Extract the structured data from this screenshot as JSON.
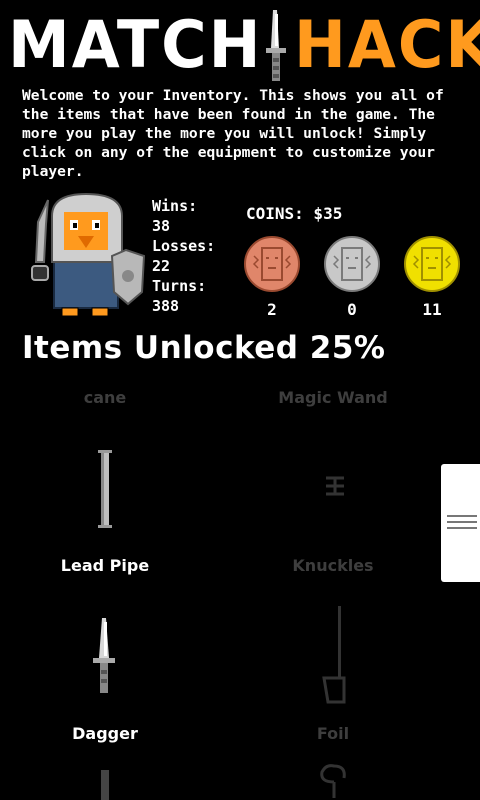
{
  "header": {
    "title_left": "MATCH",
    "title_right": "HACK"
  },
  "intro": "Welcome to your Inventory. This shows you all of the items that have been found in the game. The more you play the more you will unlock! Simply click on any of the equipment to customize your player.",
  "stats": {
    "wins_label": "Wins:",
    "wins": "38",
    "losses_label": "Losses:",
    "losses": "22",
    "turns_label": "Turns:",
    "turns": "388"
  },
  "coins": {
    "title": "COINS: $35",
    "bronze": "2",
    "silver": "0",
    "gold": "11"
  },
  "unlocked": "Items Unlocked 25%",
  "items": [
    {
      "label": "cane",
      "locked": true
    },
    {
      "label": "Magic Wand",
      "locked": true
    },
    {
      "label": "Lead Pipe",
      "locked": false
    },
    {
      "label": "Knuckles",
      "locked": true
    },
    {
      "label": "Dagger",
      "locked": false
    },
    {
      "label": "Foil",
      "locked": true
    }
  ],
  "colors": {
    "accent": "#ff9a1e",
    "locked": "#3e3e3e",
    "bronze": "#e0866a",
    "silver": "#c8c8c8",
    "gold": "#f0e000"
  }
}
